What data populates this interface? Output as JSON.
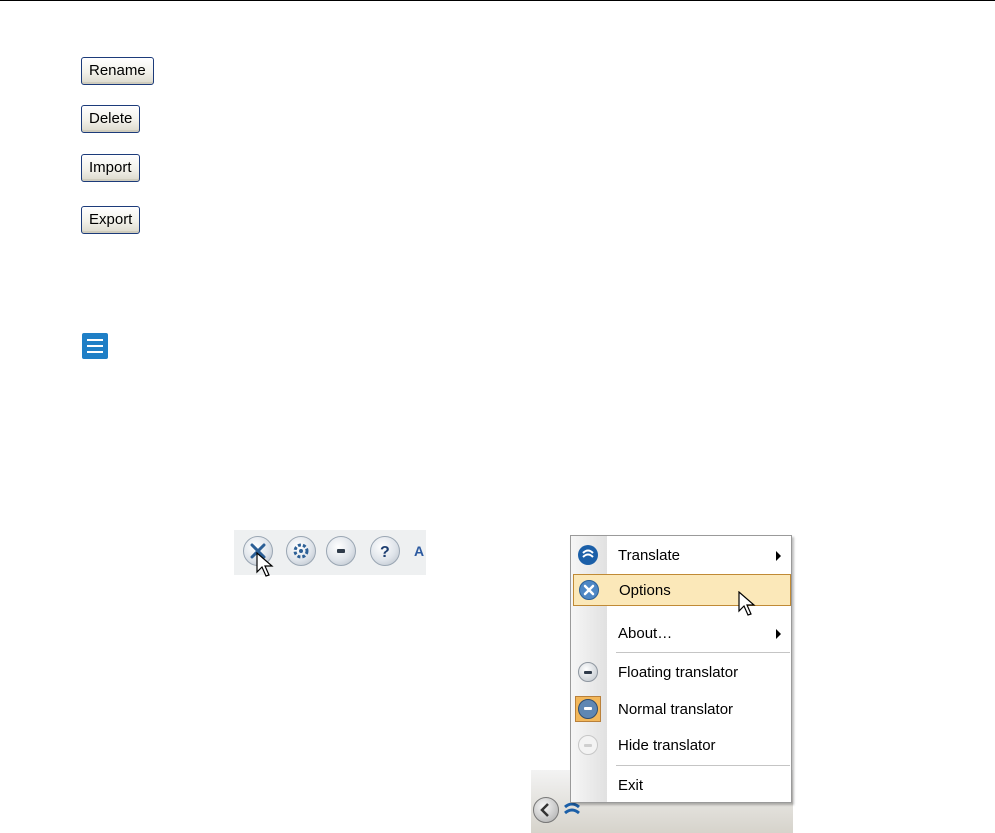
{
  "buttons": {
    "rename": "Rename",
    "delete": "Delete",
    "import": "Import",
    "export": "Export"
  },
  "icons": {
    "menu": "hamburger-menu-icon",
    "toolbar": [
      "options-icon",
      "settings-icon",
      "floating-translator-icon",
      "help-icon"
    ]
  },
  "toolbar": {
    "label": "A"
  },
  "context_menu": {
    "items": [
      {
        "label": "Translate",
        "icon": "translate-icon",
        "submenu": true
      },
      {
        "label": "Options",
        "icon": "options-icon",
        "highlighted": true
      },
      {
        "label": "About…",
        "submenu": true
      },
      {
        "label": "Floating translator",
        "icon": "floating-translator-icon"
      },
      {
        "label": "Normal translator",
        "icon": "normal-translator-icon",
        "checked": true
      },
      {
        "label": "Hide translator",
        "icon": "hide-translator-icon"
      },
      {
        "label": "Exit"
      }
    ]
  },
  "colors": {
    "highlight": "#fbe8b9",
    "accent": "#1f7fc6"
  }
}
